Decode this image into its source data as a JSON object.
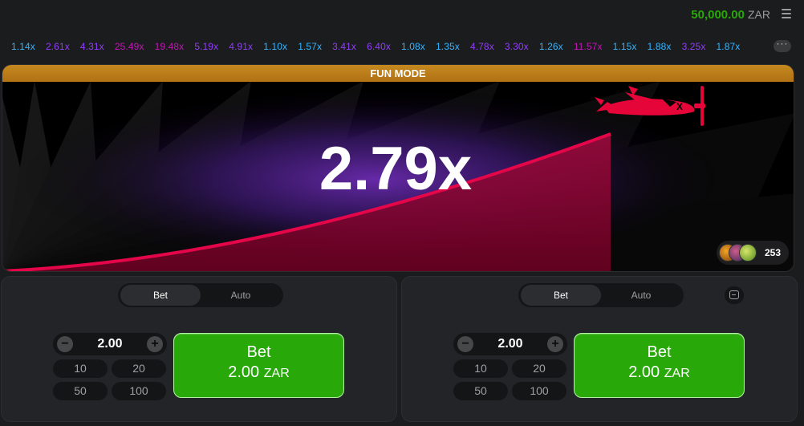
{
  "header": {
    "balance": "50,000.00",
    "currency": "ZAR",
    "menu_icon": "hamburger-menu-icon"
  },
  "history": {
    "multipliers": [
      {
        "value": "1.14x",
        "color": "blue"
      },
      {
        "value": "2.61x",
        "color": "purple"
      },
      {
        "value": "4.31x",
        "color": "purple"
      },
      {
        "value": "25.49x",
        "color": "pink"
      },
      {
        "value": "19.48x",
        "color": "pink"
      },
      {
        "value": "5.19x",
        "color": "purple"
      },
      {
        "value": "4.91x",
        "color": "purple"
      },
      {
        "value": "1.10x",
        "color": "blue"
      },
      {
        "value": "1.57x",
        "color": "blue"
      },
      {
        "value": "3.41x",
        "color": "purple"
      },
      {
        "value": "6.40x",
        "color": "purple"
      },
      {
        "value": "1.08x",
        "color": "blue"
      },
      {
        "value": "1.35x",
        "color": "blue"
      },
      {
        "value": "4.78x",
        "color": "purple"
      },
      {
        "value": "3.30x",
        "color": "purple"
      },
      {
        "value": "1.26x",
        "color": "blue"
      },
      {
        "value": "11.57x",
        "color": "pink"
      },
      {
        "value": "1.15x",
        "color": "blue"
      },
      {
        "value": "1.88x",
        "color": "blue"
      },
      {
        "value": "3.25x",
        "color": "purple"
      },
      {
        "value": "1.87x",
        "color": "blue"
      }
    ],
    "more_label": "···"
  },
  "game": {
    "mode_banner": "FUN MODE",
    "multiplier": "2.79x",
    "players_count": "253",
    "colors": {
      "curve": "#e5064a",
      "banner": "#c6891f",
      "plane": "#e50539"
    }
  },
  "panels": [
    {
      "tabs": [
        "Bet",
        "Auto"
      ],
      "active_tab": "Bet",
      "stake": "2.00",
      "quick_amounts": [
        "10",
        "20",
        "50",
        "100"
      ],
      "bet_label": "Bet",
      "bet_amount": "2.00",
      "bet_currency": "ZAR"
    },
    {
      "tabs": [
        "Bet",
        "Auto"
      ],
      "active_tab": "Bet",
      "stake": "2.00",
      "quick_amounts": [
        "10",
        "20",
        "50",
        "100"
      ],
      "bet_label": "Bet",
      "bet_amount": "2.00",
      "bet_currency": "ZAR"
    }
  ],
  "colors": {
    "accent_green": "#28a909",
    "bg": "#1b1c1d",
    "panel": "#232427"
  }
}
